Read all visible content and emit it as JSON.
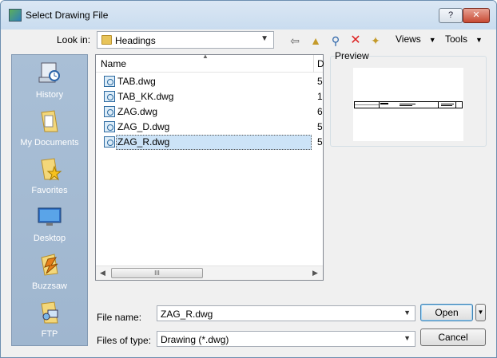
{
  "window": {
    "title": "Select Drawing File",
    "help_label": "?",
    "close_label": "✕"
  },
  "toolbar": {
    "look_in_label": "Look in:",
    "look_in_value": "Headings",
    "views_label": "Views",
    "tools_label": "Tools"
  },
  "places": [
    {
      "label": "History",
      "icon": "history-icon"
    },
    {
      "label": "My Documents",
      "icon": "documents-folder-icon"
    },
    {
      "label": "Favorites",
      "icon": "favorites-folder-icon"
    },
    {
      "label": "Desktop",
      "icon": "desktop-icon"
    },
    {
      "label": "Buzzsaw",
      "icon": "buzzsaw-icon"
    },
    {
      "label": "FTP",
      "icon": "ftp-icon"
    }
  ],
  "file_list": {
    "columns": {
      "name": "Name",
      "second": "D"
    },
    "files": [
      {
        "name": "TAB.dwg",
        "col2": "5"
      },
      {
        "name": "TAB_KK.dwg",
        "col2": "1"
      },
      {
        "name": "ZAG.dwg",
        "col2": "6"
      },
      {
        "name": "ZAG_D.dwg",
        "col2": "5"
      },
      {
        "name": "ZAG_R.dwg",
        "col2": "5",
        "selected": true
      }
    ],
    "scroll_thumb_grip": "III"
  },
  "preview": {
    "label": "Preview"
  },
  "footer": {
    "file_name_label": "File name:",
    "file_name_value": "ZAG_R.dwg",
    "files_of_type_label": "Files of type:",
    "files_of_type_value": "Drawing (*.dwg)",
    "open_label": "Open",
    "cancel_label": "Cancel"
  }
}
